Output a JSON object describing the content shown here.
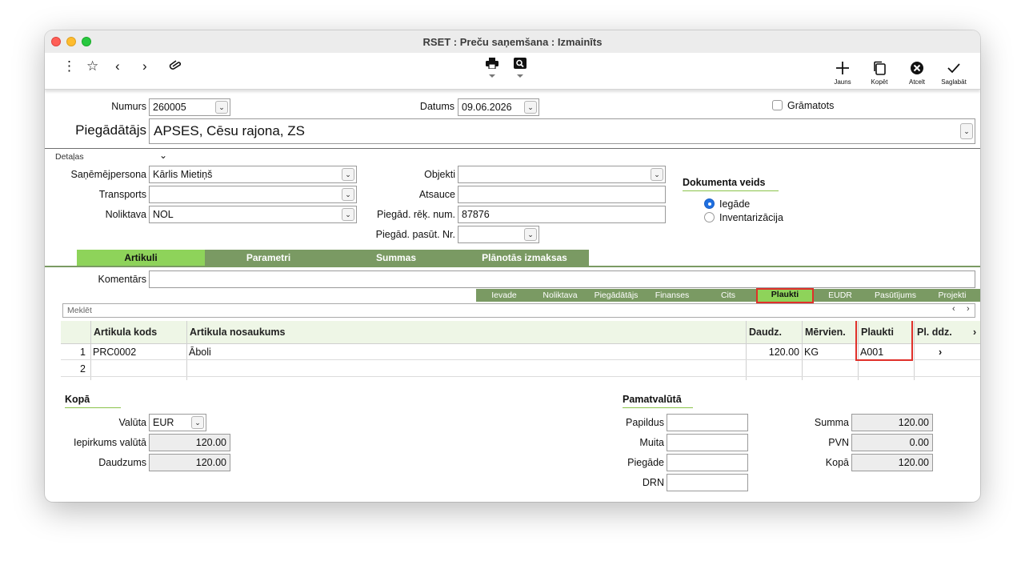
{
  "window": {
    "title": "RSET : Preču saņemšana : Izmainīts"
  },
  "toolbar": {
    "actions": [
      {
        "label": "Jauns",
        "icon": "plus-icon"
      },
      {
        "label": "Kopēt",
        "icon": "copy-icon"
      },
      {
        "label": "Atcelt",
        "icon": "cancel-icon"
      },
      {
        "label": "Saglabāt",
        "icon": "checkmark-icon"
      }
    ]
  },
  "header": {
    "numurs_label": "Numurs",
    "numurs_value": "260005",
    "datums_label": "Datums",
    "datums_value": "09.06.2026",
    "gramatots_label": "Grāmatots",
    "piegadatajs_label": "Piegādātājs",
    "piegadatajs_value": "APSES, Cēsu rajona, ZS"
  },
  "details": {
    "toggle_label": "Detaļas",
    "sanemejpersona_label": "Saņēmējpersona",
    "sanemejpersona_value": "Kārlis Mietiņš",
    "transports_label": "Transports",
    "transports_value": "",
    "noliktava_label": "Noliktava",
    "noliktava_value": "NOL",
    "objekti_label": "Objekti",
    "objekti_value": "",
    "atsauce_label": "Atsauce",
    "atsauce_value": "",
    "piegad_rek_label": "Piegād. rēķ. num.",
    "piegad_rek_value": "87876",
    "piegad_pasut_label": "Piegād. pasūt. Nr.",
    "piegad_pasut_value": "",
    "doc_type_title": "Dokumenta veids",
    "doc_type_options": [
      "Iegāde",
      "Inventarizācija"
    ],
    "doc_type_selected": "Iegāde"
  },
  "tabs": [
    "Artikuli",
    "Parametri",
    "Summas",
    "Plānotās izmaksas"
  ],
  "active_tab": "Artikuli",
  "komentars_label": "Komentārs",
  "komentars_value": "",
  "subtabs": [
    "Ievade",
    "Noliktava",
    "Piegādātājs",
    "Finanses",
    "Cits",
    "Plaukti",
    "EUDR",
    "Pasūtījums",
    "Projekti"
  ],
  "active_subtab": "Plaukti",
  "search_placeholder": "Meklēt",
  "grid": {
    "columns": [
      "Artikula kods",
      "Artikula nosaukums",
      "Daudz.",
      "Mērvien.",
      "Plaukti",
      "Pl. ddz."
    ],
    "rows": [
      {
        "n": "1",
        "kods": "PRC0002",
        "nosaukums": "Āboli",
        "daudz": "120.00",
        "mervien": "KG",
        "plaukti": "A001"
      },
      {
        "n": "2",
        "kods": "",
        "nosaukums": "",
        "daudz": "",
        "mervien": "",
        "plaukti": ""
      }
    ]
  },
  "kopa": {
    "title": "Kopā",
    "valuta_label": "Valūta",
    "valuta_value": "EUR",
    "iepirkums_label": "Iepirkums valūtā",
    "iepirkums_value": "120.00",
    "daudzums_label": "Daudzums",
    "daudzums_value": "120.00"
  },
  "pamatvaluta": {
    "title": "Pamatvalūtā",
    "papildus_label": "Papildus",
    "muita_label": "Muita",
    "piegade_label": "Piegāde",
    "drn_label": "DRN",
    "summa_label": "Summa",
    "summa_value": "120.00",
    "pvn_label": "PVN",
    "pvn_value": "0.00",
    "kopa_label": "Kopā",
    "kopa_value": "120.00"
  },
  "colors": {
    "tab_bg": "#7a9a63",
    "tab_active": "#8ed35a",
    "highlight": "#e0302a"
  }
}
